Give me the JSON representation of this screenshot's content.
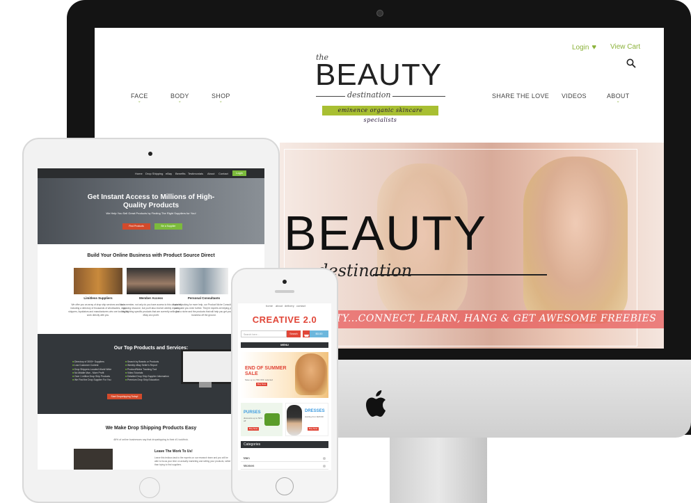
{
  "desktop": {
    "header": {
      "login": "Login",
      "view_cart": "View Cart"
    },
    "nav_left": [
      "FACE",
      "BODY",
      "SHOP"
    ],
    "nav_right": [
      "SHARE THE LOVE",
      "VIDEOS",
      "ABOUT"
    ],
    "logo": {
      "the": "the",
      "main": "BEAUTY",
      "script": "destination",
      "tagline": "eminence organic skincare specialists"
    },
    "hero": {
      "title": "BEAUTY",
      "script": "destination",
      "band_text": "PARTY...CONNECT, LEARN, HANG & GET AWESOME FREEBIES"
    },
    "colors": {
      "accent": "#8bb23a",
      "tagline_bg": "#a8bf32",
      "band": "#e85c5c"
    }
  },
  "tablet": {
    "nav": [
      "Home",
      "Drop Shipping",
      "eBay",
      "Benefits",
      "Testimonials",
      "About",
      "Contact"
    ],
    "login": "Login",
    "hero": {
      "title": "Get Instant Access to Millions of High-Quality Products",
      "subtitle": "We Help You Sell Great Products by Finding The Right Suppliers for You!",
      "button_primary": "Find Products",
      "button_secondary": "Be a Supplier"
    },
    "section1": {
      "heading": "Build Your Online Business with Product Source Direct",
      "features": [
        {
          "title": "Limitless Suppliers",
          "text": "We offer you an array of drop ship services and tools including a directory of thousands of wholesalers, drop shippers, liquidators and manufacturers who are looking to work directly with you."
        },
        {
          "title": "Member Access",
          "text": "As a member, not only do you have access to this constantly growing resource, but you'll also receive weekly reports highlighting specific products that are currently selling on eBay at a profit."
        },
        {
          "title": "Personal Consultants",
          "text": "If you're looking for more help, our Product Niche Consultants can guide you even further. They're experts at helping you find a niche and the products that will help you get your business off the ground."
        }
      ]
    },
    "section2": {
      "heading": "Our Top Products and Services:",
      "list_left": [
        "Directory of 3000+ Suppliers",
        "Low Customer Contest",
        "Drop Shippers Located World Wide",
        "No Middle Man - More Profit",
        "Over 1 million Drop Ship Products",
        "We Find the Drop Supplier For You"
      ],
      "list_right": [
        "Search by Brands or Products",
        "Weekly eBay Seller's Report",
        "Product/Niche Tracking Tool",
        "Video Tutorials",
        "Detailed Drop Ship Supplier Information",
        "Premium Drop Ship Education"
      ],
      "button": "Start Dropshipping Today!"
    },
    "section3": {
      "heading": "We Make Drop Shipping Products Easy",
      "text": "46% of online businesses say that dropshipping is their #1 tool/trick.",
      "sub_heading": "Leave The Work To Us!",
      "sub_text": "Leave this tedious task to the experts on our research team and you will be able to focus your time on actually marketing and selling your products, rather than trying to find suppliers."
    },
    "colors": {
      "nav_bg": "#2b2d2f",
      "green": "#7cbb3c",
      "red": "#d34a2b",
      "dark": "#33373b"
    }
  },
  "phone": {
    "nav": [
      "home",
      "about",
      "delivery",
      "contact"
    ],
    "title": "CREATIVE 2.0",
    "search_placeholder": "Search here...",
    "search_button": "Search",
    "cart_price": "$0.00",
    "menu_label": "MENU",
    "banner": {
      "title": "END OF SUMMER SALE",
      "subtitle": "Save up to 70% OFF selected",
      "button": "Buy Now"
    },
    "promo1": {
      "title": "PURSES",
      "subtitle": "discounts up to 50% off",
      "button": "Buy Now"
    },
    "promo2": {
      "title": "DRESSES",
      "subtitle": "starting from $29.99",
      "button": "Buy Now"
    },
    "categories_label": "Categories",
    "categories": [
      "Men",
      "Women"
    ],
    "colors": {
      "red": "#e14638",
      "blue": "#3d9be0",
      "dark": "#2f3235"
    }
  }
}
